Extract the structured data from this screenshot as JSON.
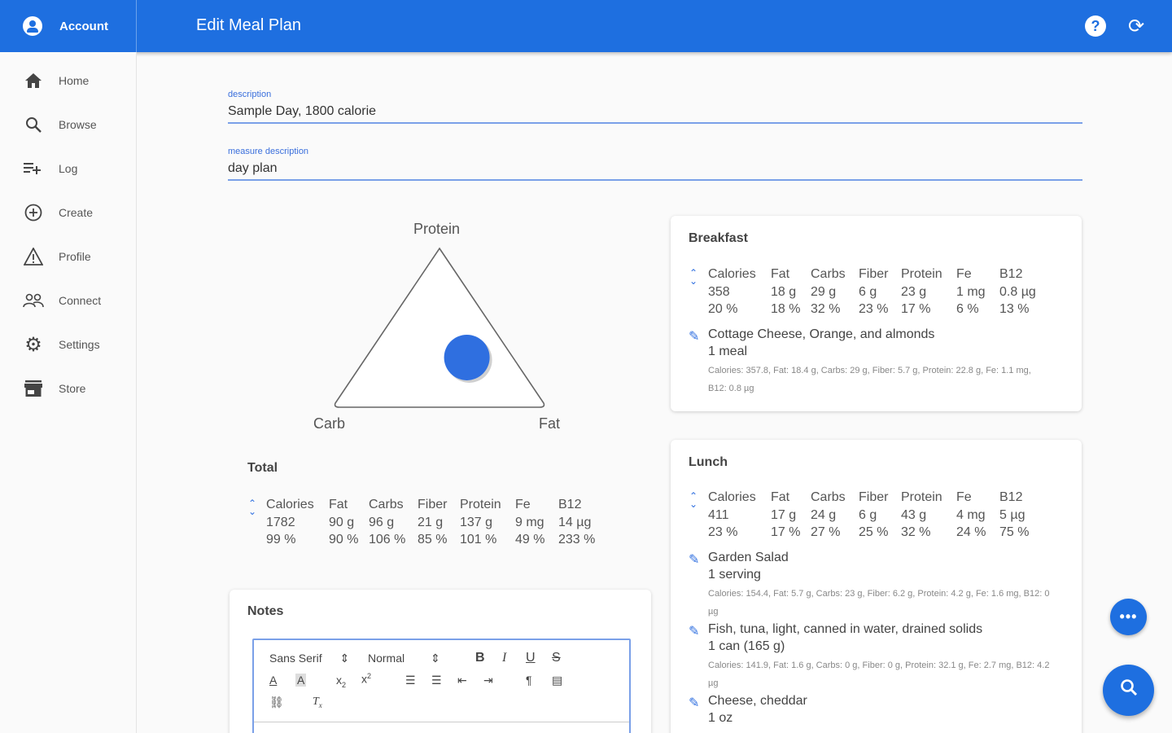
{
  "header": {
    "account_label": "Account",
    "title": "Edit Meal Plan",
    "help_icon": "help-circle-icon",
    "sync_icon": "sync-icon"
  },
  "colors": {
    "primary": "#1e6fe0",
    "accent_line": "#7aa0e8"
  },
  "sidebar": {
    "items": [
      {
        "label": "Home",
        "icon": "home-icon"
      },
      {
        "label": "Browse",
        "icon": "search-icon"
      },
      {
        "label": "Log",
        "icon": "playlist-add-icon"
      },
      {
        "label": "Create",
        "icon": "add-circle-icon"
      },
      {
        "label": "Profile",
        "icon": "warning-triangle-icon"
      },
      {
        "label": "Connect",
        "icon": "people-icon"
      },
      {
        "label": "Settings",
        "icon": "gear-icon"
      },
      {
        "label": "Store",
        "icon": "store-icon"
      }
    ]
  },
  "form": {
    "description_label": "description",
    "description_value": "Sample Day, 1800 calorie",
    "measure_label": "measure description",
    "measure_value": "day plan"
  },
  "chart_data": {
    "type": "ternary",
    "axes": [
      "Protein",
      "Carb",
      "Fat"
    ],
    "point": {
      "protein": 0.31,
      "carb": 0.21,
      "fat": 0.47
    }
  },
  "total": {
    "title": "Total",
    "columns": [
      {
        "header": "Calories",
        "amount": "1782",
        "percent": "99 %"
      },
      {
        "header": "Fat",
        "amount": "90 g",
        "percent": "90 %"
      },
      {
        "header": "Carbs",
        "amount": "96 g",
        "percent": "106 %"
      },
      {
        "header": "Fiber",
        "amount": "21 g",
        "percent": "85 %"
      },
      {
        "header": "Protein",
        "amount": "137 g",
        "percent": "101 %"
      },
      {
        "header": "Fe",
        "amount": "9 mg",
        "percent": "49 %"
      },
      {
        "header": "B12",
        "amount": "14 µg",
        "percent": "233 %"
      }
    ]
  },
  "notes": {
    "title": "Notes",
    "font_select": "Sans Serif",
    "size_select": "Normal"
  },
  "meals": [
    {
      "title": "Breakfast",
      "columns": [
        {
          "header": "Calories",
          "amount": "358",
          "percent": "20 %"
        },
        {
          "header": "Fat",
          "amount": "18 g",
          "percent": "18 %"
        },
        {
          "header": "Carbs",
          "amount": "29 g",
          "percent": "32 %"
        },
        {
          "header": "Fiber",
          "amount": "6 g",
          "percent": "23 %"
        },
        {
          "header": "Protein",
          "amount": "23 g",
          "percent": "17 %"
        },
        {
          "header": "Fe",
          "amount": "1 mg",
          "percent": "6 %"
        },
        {
          "header": "B12",
          "amount": "0.8 µg",
          "percent": "13 %"
        }
      ],
      "foods": [
        {
          "name": "Cottage Cheese, Orange, and almonds",
          "qty": "1 meal",
          "detail": "Calories: 357.8, Fat: 18.4 g, Carbs: 29 g, Fiber: 5.7 g, Protein: 22.8 g, Fe: 1.1 mg, B12: 0.8 µg"
        }
      ]
    },
    {
      "title": "Lunch",
      "columns": [
        {
          "header": "Calories",
          "amount": "411",
          "percent": "23 %"
        },
        {
          "header": "Fat",
          "amount": "17 g",
          "percent": "17 %"
        },
        {
          "header": "Carbs",
          "amount": "24 g",
          "percent": "27 %"
        },
        {
          "header": "Fiber",
          "amount": "6 g",
          "percent": "25 %"
        },
        {
          "header": "Protein",
          "amount": "43 g",
          "percent": "32 %"
        },
        {
          "header": "Fe",
          "amount": "4 mg",
          "percent": "24 %"
        },
        {
          "header": "B12",
          "amount": "5 µg",
          "percent": "75 %"
        }
      ],
      "foods": [
        {
          "name": "Garden Salad",
          "qty": "1 serving",
          "detail": "Calories: 154.4, Fat: 5.7 g, Carbs: 23 g, Fiber: 6.2 g, Protein: 4.2 g, Fe: 1.6 mg, B12: 0 µg"
        },
        {
          "name": "Fish, tuna, light, canned in water, drained solids",
          "qty": "1 can (165 g)",
          "detail": "Calories: 141.9, Fat: 1.6 g, Carbs: 0 g, Fiber: 0 g, Protein: 32.1 g, Fe: 2.7 mg, B12: 4.2 µg"
        },
        {
          "name": "Cheese, cheddar",
          "qty": "1 oz"
        }
      ]
    }
  ],
  "fabs": {
    "more_icon": "more-horizontal-icon",
    "search_icon": "search-icon"
  }
}
